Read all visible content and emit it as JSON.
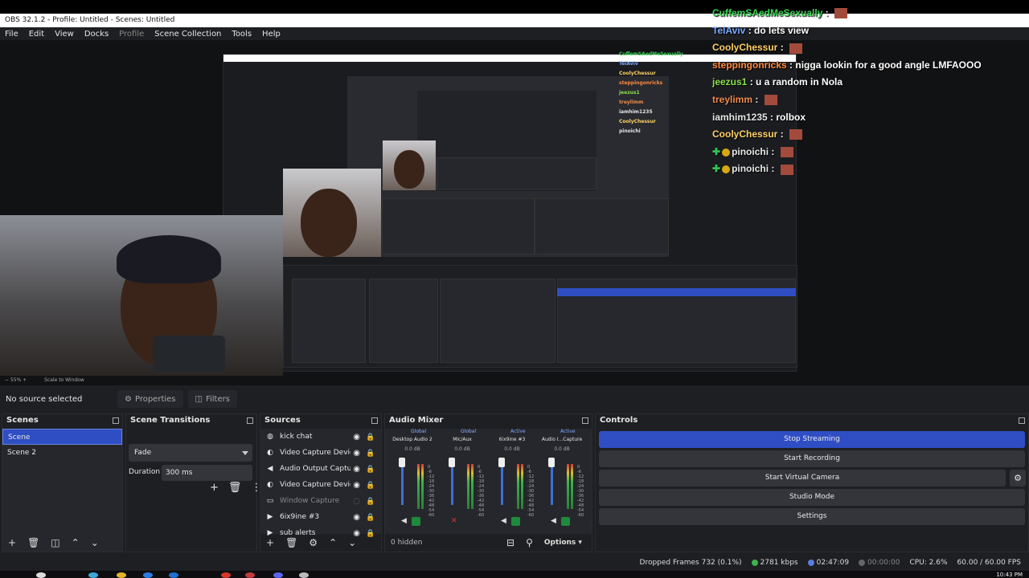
{
  "window": {
    "title": "OBS 32.1.2 - Profile: Untitled - Scenes: Untitled"
  },
  "menu": [
    {
      "label": "File"
    },
    {
      "label": "Edit"
    },
    {
      "label": "View"
    },
    {
      "label": "Docks"
    },
    {
      "label": "Profile",
      "disabled": true
    },
    {
      "label": "Scene Collection"
    },
    {
      "label": "Tools"
    },
    {
      "label": "Help"
    }
  ],
  "preview": {
    "zoom_label": "55%",
    "scale_label": "Scale to Window"
  },
  "chat": [
    {
      "user": "CuffemSAedMeSexually",
      "color": "#39d353",
      "msg": "",
      "emote": true
    },
    {
      "user": "TelAviv",
      "color": "#7aa7ff",
      "msg": "do lets view",
      "emote": false
    },
    {
      "user": "CoolyChessur",
      "color": "#ffd166",
      "msg": "",
      "emote": true
    },
    {
      "user": "steppingonricks",
      "color": "#ff8a3d",
      "msg": "nigga lookin for a good angle LMFAOOO",
      "emote": false
    },
    {
      "user": "jeezus1",
      "color": "#8be04e",
      "msg": "u a random in Nola",
      "emote": false
    },
    {
      "user": "treylimm",
      "color": "#f08a4b",
      "msg": "",
      "emote": true
    },
    {
      "user": "iamhim1235",
      "color": "#e7e7e7",
      "msg": "rolbox",
      "emote": false
    },
    {
      "user": "CoolyChessur",
      "color": "#ffd166",
      "msg": "",
      "emote": true
    },
    {
      "user": "pinoichi",
      "color": "#e7e7e7",
      "msg": "",
      "emote": true,
      "badges": true
    },
    {
      "user": "pinoichi",
      "color": "#e7e7e7",
      "msg": "",
      "emote": true,
      "badges": true
    }
  ],
  "source_bar": {
    "no_source": "No source selected",
    "properties": "Properties",
    "filters": "Filters"
  },
  "scenes": {
    "title": "Scenes",
    "items": [
      {
        "label": "Scene",
        "selected": true
      },
      {
        "label": "Scene 2",
        "selected": false
      }
    ]
  },
  "transitions": {
    "title": "Scene Transitions",
    "selected": "Fade",
    "duration_label": "Duration",
    "duration_value": "300 ms"
  },
  "sources": {
    "title": "Sources",
    "items": [
      {
        "label": "kick chat",
        "icon": "browser-icon",
        "visible": true
      },
      {
        "label": "Video Capture Device",
        "icon": "camera-icon",
        "visible": true
      },
      {
        "label": "Audio Output Capture",
        "icon": "speaker-icon",
        "visible": true
      },
      {
        "label": "Video Capture Device",
        "icon": "camera-icon",
        "visible": true
      },
      {
        "label": "Window Capture",
        "icon": "window-icon",
        "visible": false
      },
      {
        "label": "6ix9ine #3",
        "icon": "media-icon",
        "visible": true
      },
      {
        "label": "sub alerts",
        "icon": "media-icon",
        "visible": true
      }
    ]
  },
  "mixer": {
    "title": "Audio Mixer",
    "channels": [
      {
        "name": "Desktop Audio 2",
        "tag": "Global",
        "db": "0.0 dB",
        "fader": 0.95,
        "muted": false
      },
      {
        "name": "Mic/Aux",
        "tag": "Global",
        "db": "0.0 dB",
        "fader": 0.95,
        "muted": true
      },
      {
        "name": "6ix9ine #3",
        "tag": "Active",
        "db": "0.0 dB",
        "fader": 0.95,
        "muted": false
      },
      {
        "name": "Audio I...Capture",
        "tag": "Active",
        "db": "0.0 dB",
        "fader": 0.95,
        "muted": false
      }
    ],
    "scale": [
      "0",
      "-6",
      "-12",
      "-18",
      "-24",
      "-30",
      "-36",
      "-42",
      "-48",
      "-54",
      "-60"
    ],
    "hidden_label": "0 hidden",
    "options_label": "Options"
  },
  "controls": {
    "title": "Controls",
    "buttons": [
      {
        "label": "Stop Streaming",
        "primary": true
      },
      {
        "label": "Start Recording",
        "primary": false
      },
      {
        "label": "Start Virtual Camera",
        "primary": false
      },
      {
        "label": "Studio Mode",
        "primary": false
      },
      {
        "label": "Settings",
        "primary": false
      }
    ]
  },
  "status": {
    "dropped": "Dropped Frames 732 (0.1%)",
    "bitrate": "2781 kbps",
    "stream_time": "02:47:09",
    "rec_time": "00:00:00",
    "cpu": "CPU: 2.6%",
    "fps": "60.00 / 60.00 FPS"
  },
  "taskbar": {
    "clock": "10:43 PM"
  },
  "colors": {
    "accent": "#2f4ec4",
    "panel": "#26272c",
    "bg": "#1e1f22"
  }
}
